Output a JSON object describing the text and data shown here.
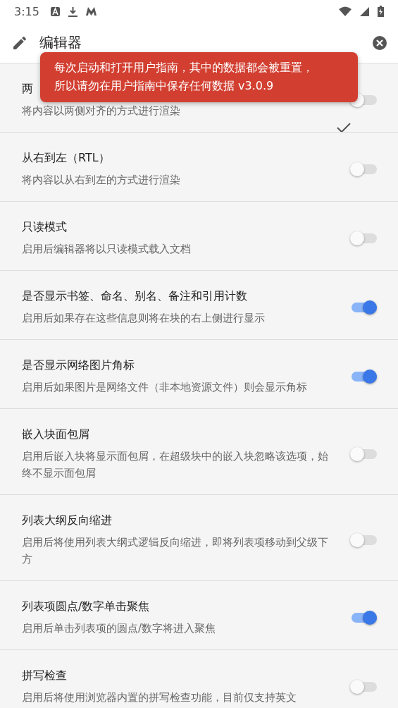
{
  "status_bar": {
    "time": "3:15"
  },
  "header": {
    "title": "编辑器"
  },
  "toast": {
    "lines": [
      "每次启动和打开用户指南，其中的数据都会被重置，",
      "所以请勿在用户指南中保存任何数据 v3.0.9"
    ]
  },
  "settings": [
    {
      "title": "两",
      "description": "将内容以两侧对齐的方式进行渲染",
      "on": false,
      "ticked": true
    },
    {
      "title": "从右到左（RTL）",
      "description": "将内容以从右到左的方式进行渲染",
      "on": false,
      "ticked": false
    },
    {
      "title": "只读模式",
      "description": "启用后编辑器将以只读模式载入文档",
      "on": false,
      "ticked": false
    },
    {
      "title": "是否显示书签、命名、别名、备注和引用计数",
      "description": "启用后如果存在这些信息则将在块的右上侧进行显示",
      "on": true,
      "ticked": false
    },
    {
      "title": "是否显示网络图片角标",
      "description": "启用后如果图片是网络文件（非本地资源文件）则会显示角标",
      "on": true,
      "ticked": false
    },
    {
      "title": "嵌入块面包屑",
      "description": "启用后嵌入块将显示面包屑，在超级块中的嵌入块忽略该选项，始终不显示面包屑",
      "on": false,
      "ticked": false
    },
    {
      "title": "列表大纲反向缩进",
      "description": "启用后将使用列表大纲式逻辑反向缩进，即将列表项移动到父级下方",
      "on": false,
      "ticked": false
    },
    {
      "title": "列表项圆点/数字单击聚焦",
      "description": "启用后单击列表项的圆点/数字将进入聚焦",
      "on": true,
      "ticked": false
    },
    {
      "title": "拼写检查",
      "description": "启用后将使用浏览器内置的拼写检查功能，目前仅支持英文",
      "on": false,
      "ticked": false
    }
  ]
}
